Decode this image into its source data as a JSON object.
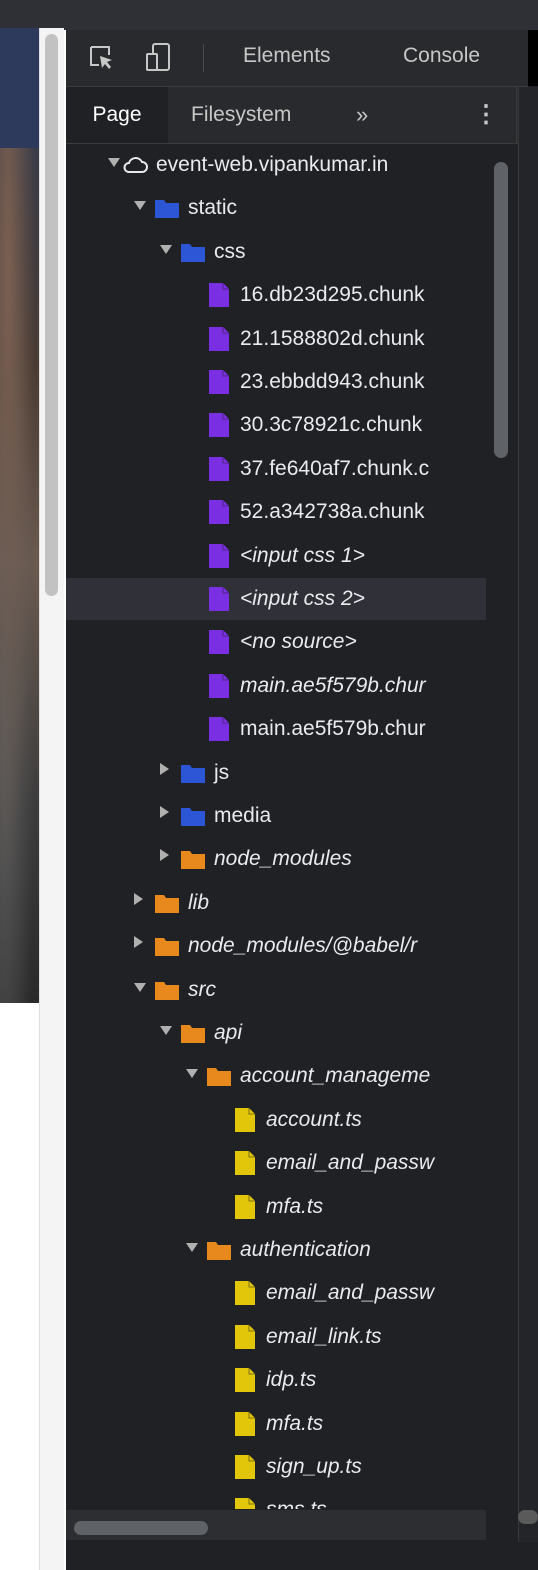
{
  "toolbar": {
    "tabs": [
      "Elements",
      "Console"
    ]
  },
  "sources": {
    "tabs": [
      "Page",
      "Filesystem"
    ],
    "more_symbol": "»",
    "menu_symbol": "⋮"
  },
  "colors": {
    "blue_folder": "#2c56d6",
    "orange_folder": "#e8891e",
    "css_file": "#7b2fe3",
    "ts_file": "#e2c60a"
  },
  "tree": [
    {
      "label": "event-web.vipankumar.in",
      "level": 0,
      "kind": "domain",
      "expanded": true,
      "italic": false
    },
    {
      "label": "static",
      "level": 1,
      "kind": "folder-blue",
      "expanded": true,
      "italic": false
    },
    {
      "label": "css",
      "level": 2,
      "kind": "folder-blue",
      "expanded": true,
      "italic": false
    },
    {
      "label": "16.db23d295.chunk",
      "level": 3,
      "kind": "css",
      "italic": false
    },
    {
      "label": "21.1588802d.chunk",
      "level": 3,
      "kind": "css",
      "italic": false
    },
    {
      "label": "23.ebbdd943.chunk",
      "level": 3,
      "kind": "css",
      "italic": false
    },
    {
      "label": "30.3c78921c.chunk",
      "level": 3,
      "kind": "css",
      "italic": false
    },
    {
      "label": "37.fe640af7.chunk.c",
      "level": 3,
      "kind": "css",
      "italic": false
    },
    {
      "label": "52.a342738a.chunk",
      "level": 3,
      "kind": "css",
      "italic": false
    },
    {
      "label": "<input css 1>",
      "level": 3,
      "kind": "css",
      "italic": true
    },
    {
      "label": "<input css 2>",
      "level": 3,
      "kind": "css",
      "italic": true,
      "selected": true
    },
    {
      "label": "<no source>",
      "level": 3,
      "kind": "css",
      "italic": true
    },
    {
      "label": "main.ae5f579b.chur",
      "level": 3,
      "kind": "css",
      "italic": true
    },
    {
      "label": "main.ae5f579b.chur",
      "level": 3,
      "kind": "css",
      "italic": false
    },
    {
      "label": "js",
      "level": 2,
      "kind": "folder-blue",
      "expanded": false,
      "italic": false
    },
    {
      "label": "media",
      "level": 2,
      "kind": "folder-blue",
      "expanded": false,
      "italic": false
    },
    {
      "label": "node_modules",
      "level": 2,
      "kind": "folder-orange",
      "expanded": false,
      "italic": true
    },
    {
      "label": "lib",
      "level": 1,
      "kind": "folder-orange",
      "expanded": false,
      "italic": true
    },
    {
      "label": "node_modules/@babel/r",
      "level": 1,
      "kind": "folder-orange",
      "expanded": false,
      "italic": true
    },
    {
      "label": "src",
      "level": 1,
      "kind": "folder-orange",
      "expanded": true,
      "italic": true
    },
    {
      "label": "api",
      "level": 2,
      "kind": "folder-orange",
      "expanded": true,
      "italic": true
    },
    {
      "label": "account_manageme",
      "level": 3,
      "kind": "folder-orange",
      "expanded": true,
      "italic": true
    },
    {
      "label": "account.ts",
      "level": 4,
      "kind": "ts",
      "italic": true
    },
    {
      "label": "email_and_passw",
      "level": 4,
      "kind": "ts",
      "italic": true
    },
    {
      "label": "mfa.ts",
      "level": 4,
      "kind": "ts",
      "italic": true
    },
    {
      "label": "authentication",
      "level": 3,
      "kind": "folder-orange",
      "expanded": true,
      "italic": true
    },
    {
      "label": "email_and_passw",
      "level": 4,
      "kind": "ts",
      "italic": true
    },
    {
      "label": "email_link.ts",
      "level": 4,
      "kind": "ts",
      "italic": true
    },
    {
      "label": "idp.ts",
      "level": 4,
      "kind": "ts",
      "italic": true
    },
    {
      "label": "mfa.ts",
      "level": 4,
      "kind": "ts",
      "italic": true
    },
    {
      "label": "sign_up.ts",
      "level": 4,
      "kind": "ts",
      "italic": true
    },
    {
      "label": "sms.ts",
      "level": 4,
      "kind": "ts",
      "italic": true
    }
  ]
}
